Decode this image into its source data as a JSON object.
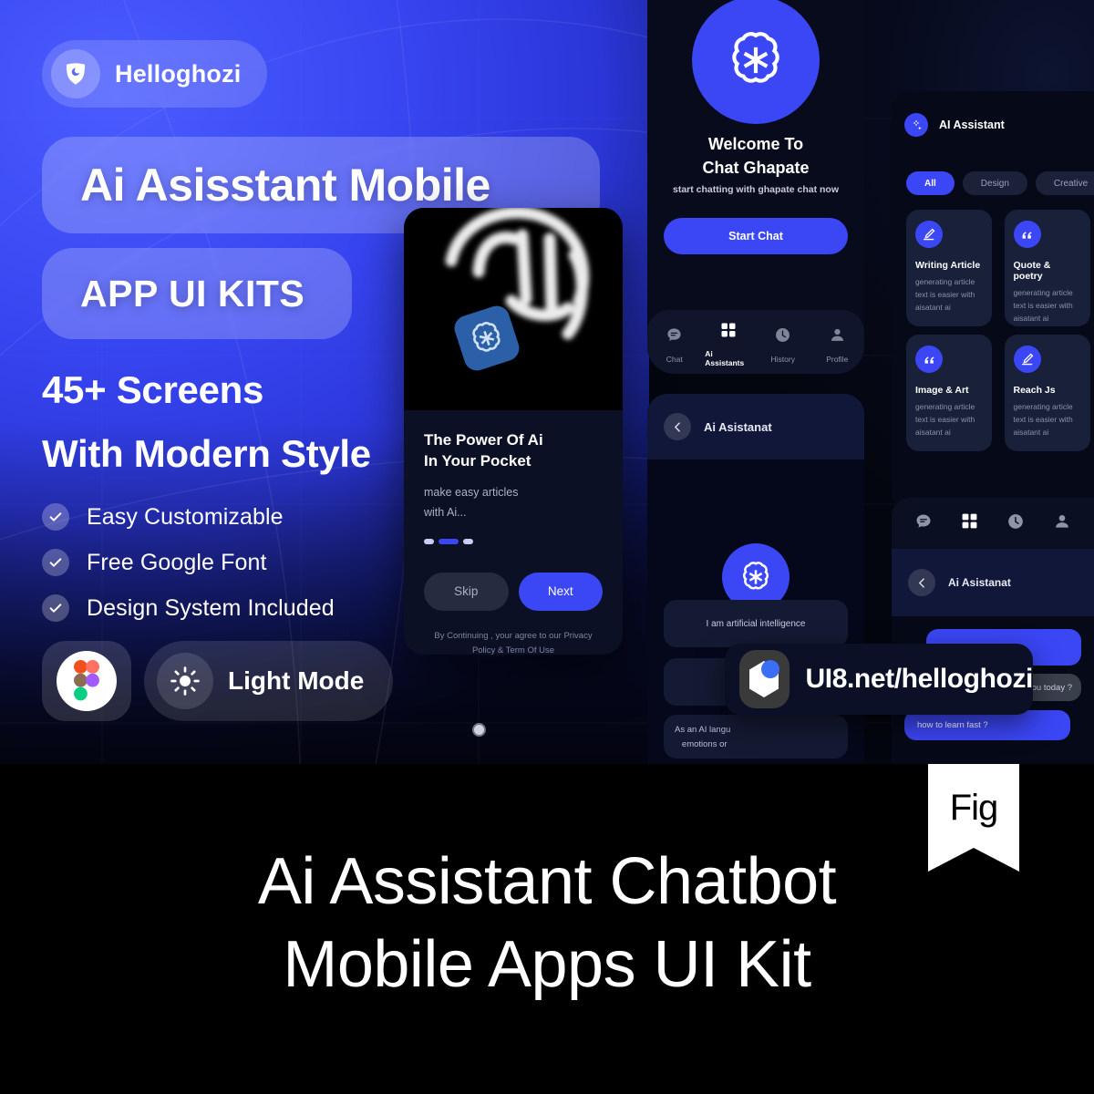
{
  "brand": {
    "name": "Helloghozi",
    "logo_icon": "ghost-shield-icon"
  },
  "hero": {
    "headline_1": "Ai Asisstant Mobile",
    "headline_2": "APP UI KITS",
    "sub_1": "45+ Screens",
    "sub_2": "With Modern Style",
    "features": [
      {
        "label": "Easy Customizable",
        "icon": "check-icon"
      },
      {
        "label": "Free Google Font",
        "icon": "check-icon"
      },
      {
        "label": "Design System Included",
        "icon": "check-icon"
      }
    ],
    "actions": {
      "figma_icon": "figma-icon",
      "light_mode_icon": "sun-icon",
      "light_mode_label": "Light Mode"
    }
  },
  "phone_onboarding": {
    "image_alt_icon": "hand-holding-phone-chatgpt-icon",
    "title_line_1": "The Power Of Ai",
    "title_line_2": "In Your Pocket",
    "sub_line_1": "make easy articles",
    "sub_line_2": "with Ai...",
    "dots": [
      false,
      true,
      false
    ],
    "skip_label": "Skip",
    "next_label": "Next",
    "terms_line_1": "By Continuing , your agree to our Privacy",
    "terms_line_2": "Policy & Term Of Use"
  },
  "phone_welcome": {
    "logo_icon": "openai-flower-icon",
    "title_line_1": "Welcome To",
    "title_line_2": "Chat Ghapate",
    "subtitle": "start chatting with ghapate chat now",
    "cta_label": "Start Chat",
    "nav": [
      {
        "label": "Chat",
        "icon": "chat-bubble-icon",
        "active": false
      },
      {
        "label": "Ai Assistants",
        "icon": "grid-icon",
        "active": true
      },
      {
        "label": "History",
        "icon": "clock-icon",
        "active": false
      },
      {
        "label": "Profile",
        "icon": "person-icon",
        "active": false
      }
    ]
  },
  "phone_chat": {
    "back_icon": "chevron-left-icon",
    "title": "Ai Asistanat",
    "avatar_icon": "openai-flower-icon",
    "message_1": "I am artificial intelligence",
    "message_2_line_1": "As an AI langu",
    "message_2_line_2": "emotions or"
  },
  "assistants_panel": {
    "header_icon": "sparkle-icon",
    "header_title": "AI Assistant",
    "tabs": [
      {
        "label": "All",
        "active": true
      },
      {
        "label": "Design",
        "active": false
      },
      {
        "label": "Creative",
        "active": false
      }
    ],
    "cards": [
      {
        "icon": "pen-write-icon",
        "title": "Writing Article",
        "desc": "generating article text is easier with aisatant ai"
      },
      {
        "icon": "quote-icon",
        "title": "Quote & poetry",
        "desc": "generating article text is easier with aisatant ai"
      },
      {
        "icon": "quote-icon",
        "title": "Image & Art",
        "desc": "generating article text is easier with aisatant ai"
      },
      {
        "icon": "pen-write-icon",
        "title": "Reach Js",
        "desc": "generating article text is easier with aisatant ai"
      }
    ]
  },
  "chat_panel": {
    "nav_icons": [
      "chat-bubble-icon",
      "grid-icon",
      "clock-icon",
      "person-icon"
    ],
    "back_icon": "chevron-left-icon",
    "title": "Ai Asistanat",
    "bubble_ai_partial": "ou today ?",
    "bubble_me": "how to learn fast ?"
  },
  "watermark": {
    "mark_icon": "ui8-hexagon-icon",
    "url": "UI8.net/helloghozi"
  },
  "footer": {
    "title_line_1": "Ai Assistant Chatbot",
    "title_line_2": "Mobile Apps UI Kit",
    "badge_label": "Fig"
  },
  "colors": {
    "brand_blue": "#3b46f5",
    "hero_blue": "#3745f0",
    "dark_bg": "#060a18",
    "panel_card": "#19203a",
    "footer_bg": "#000000"
  }
}
